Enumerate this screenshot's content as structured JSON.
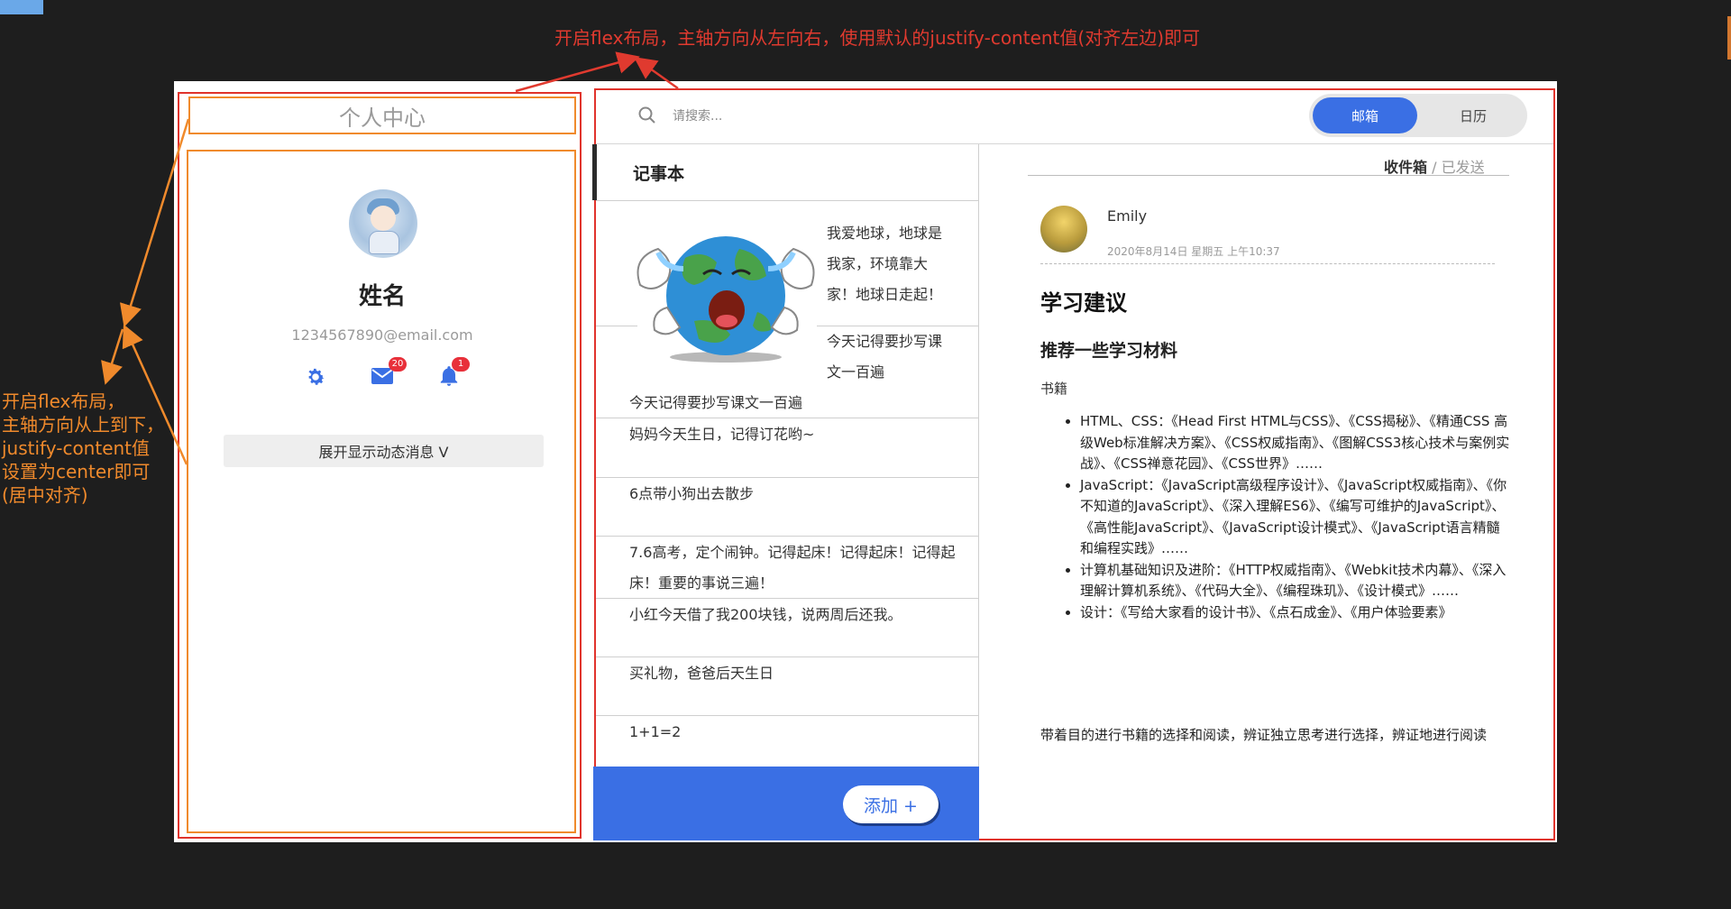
{
  "annotations": {
    "top_note": "开启flex布局，主轴方向从左向右，使用默认的justify-content值(对齐左边)即可",
    "left_note": "开启flex布局，\n主轴方向从上到下，\njustify-content值\n设置为center即可\n(居中对齐)"
  },
  "profile": {
    "title": "个人中心",
    "name": "姓名",
    "email": "1234567890@email.com",
    "icons": [
      {
        "icon": "gear-icon",
        "badge": ""
      },
      {
        "icon": "mail-icon",
        "badge": "20"
      },
      {
        "icon": "bell-icon",
        "badge": "1"
      }
    ],
    "expand_label": "展开显示动态消息 V"
  },
  "search": {
    "placeholder": "请搜索..."
  },
  "view_toggle": {
    "active": "邮箱",
    "inactive": "日历"
  },
  "notes": {
    "title": "记事本",
    "items": [
      "我爱地球，地球是我家，环境靠大家！地球日走起！",
      "今天记得要抄写课文一百遍",
      "今天记得要抄写课文一百遍",
      "妈妈今天生日，记得订花哟~",
      "6点带小狗出去散步",
      "7.6高考，定个闹钟。记得起床！记得起床！记得起床！重要的事说三遍！",
      "小红今天借了我200块钱，说两周后还我。",
      "买礼物，爸爸后天生日",
      "1+1=2"
    ],
    "add_label": "添加 +"
  },
  "mail": {
    "breadcrumb": {
      "current": "收件箱",
      "separator": "/",
      "other": "已发送"
    },
    "sender": "Emily",
    "date": "2020年8月14日 星期五 上午10:37",
    "title": "学习建议",
    "subtitle": "推荐一些学习材料",
    "section": "书籍",
    "list": [
      "HTML、CSS：《Head First HTML与CSS》、《CSS揭秘》、《精通CSS 高级Web标准解决方案》、《CSS权威指南》、《图解CSS3核心技术与案例实战》、《CSS禅意花园》、《CSS世界》……",
      "JavaScript：《JavaScript高级程序设计》、《JavaScript权威指南》、《你不知道的JavaScript》、《深入理解ES6》、《编写可维护的JavaScript》、《高性能JavaScript》、《JavaScript设计模式》、《JavaScript语言精髓和编程实践》……",
      "计算机基础知识及进阶：《HTTP权威指南》、《Webkit技术内幕》、《深入理解计算机系统》、《代码大全》、《编程珠玑》、《设计模式》……",
      "设计：《写给大家看的设计书》、《点石成金》、《用户体验要素》"
    ],
    "footer": "带着目的进行书籍的选择和阅读，辨证独立思考进行选择，辨证地进行阅读"
  },
  "colors": {
    "annotation_red": "#e03a2f",
    "annotation_orange": "#f08a2c",
    "accent_blue": "#3a6fe4"
  }
}
